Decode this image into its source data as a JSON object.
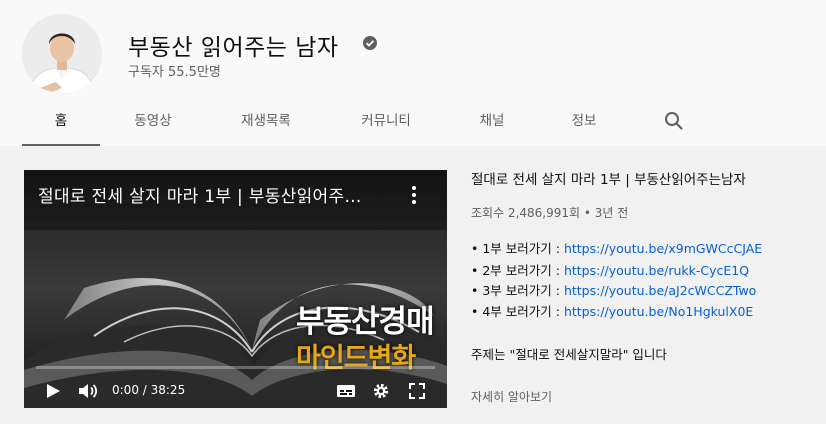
{
  "channel": {
    "name": "부동산 읽어주는 남자",
    "subscribers": "구독자 55.5만명"
  },
  "tabs": [
    {
      "label": "홈"
    },
    {
      "label": "동영상"
    },
    {
      "label": "재생목록"
    },
    {
      "label": "커뮤니티"
    },
    {
      "label": "채널"
    },
    {
      "label": "정보"
    }
  ],
  "player": {
    "title": "절대로 전세 살지 마라 1부 | 부동산읽어주…",
    "overlay_line1": "부동산경매",
    "overlay_line2": "마인드변화",
    "time": "0:00 / 38:25"
  },
  "description": {
    "title": "절대로 전세 살지 마라 1부 | 부동산읽어주는남자",
    "meta": "조회수 2,486,991회 • 3년 전",
    "links": [
      {
        "prefix": "• 1부 보러가기 : ",
        "url": "https://youtu.be/x9mGWCcCJAE"
      },
      {
        "prefix": "• 2부 보러가기 : ",
        "url": "https://youtu.be/rukk-CycE1Q"
      },
      {
        "prefix": "• 3부 보러가기 : ",
        "url": "https://youtu.be/aJ2cWCCZTwo"
      },
      {
        "prefix": "• 4부 보러가기 : ",
        "url": "https://youtu.be/No1HgkulX0E"
      }
    ],
    "topic": "주제는 \"절대로 전세살지말라\" 입니다",
    "more": "자세히 알아보기"
  },
  "colors": {
    "link": "#065fd4",
    "overlay_gold": "#e6a817"
  }
}
